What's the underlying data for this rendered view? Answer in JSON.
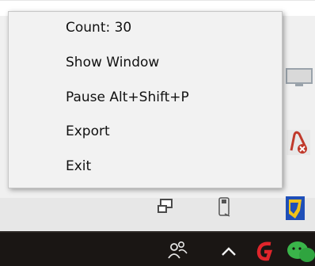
{
  "context_menu": {
    "items": [
      {
        "label": "Count: 30"
      },
      {
        "label": "Show Window"
      },
      {
        "label": "Pause Alt+Shift+P"
      },
      {
        "label": "Export"
      },
      {
        "label": "Exit"
      }
    ]
  },
  "tray_overflow": {
    "icons": [
      "monitor-icon",
      "onedrive-off-icon",
      "explorer-icon",
      "usb-icon",
      "app-blue-yellow-icon"
    ]
  },
  "taskbar": {
    "icons": [
      "people-icon",
      "chevron-up-icon",
      "red-app-icon",
      "green-app-icon"
    ]
  },
  "colors": {
    "menu_bg": "#f2f2f2",
    "menu_border": "#c7c7c7",
    "taskbar_bg": "#1a1614",
    "overflow_bg": "#f0f0f0"
  }
}
